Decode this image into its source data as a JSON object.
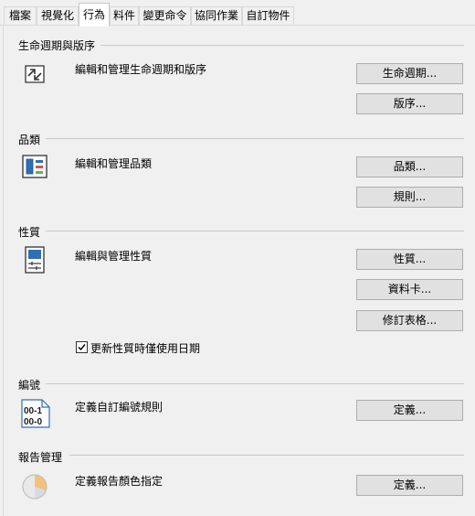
{
  "tabs": [
    {
      "label": "檔案",
      "active": false
    },
    {
      "label": "視覺化",
      "active": false
    },
    {
      "label": "行為",
      "active": true
    },
    {
      "label": "料件",
      "active": false
    },
    {
      "label": "變更命令",
      "active": false
    },
    {
      "label": "協同作業",
      "active": false
    },
    {
      "label": "自訂物件",
      "active": false
    }
  ],
  "groups": {
    "lifecycle": {
      "title": "生命週期與版序",
      "description": "編輯和管理生命週期和版序",
      "icon": "lifecycle-icon",
      "buttons": [
        "生命週期...",
        "版序..."
      ]
    },
    "category": {
      "title": "品類",
      "description": "編輯和管理品類",
      "icon": "category-icon",
      "buttons": [
        "品類...",
        "規則..."
      ]
    },
    "property": {
      "title": "性質",
      "description": "編輯與管理性質",
      "icon": "property-icon",
      "buttons": [
        "性質...",
        "資料卡...",
        "修訂表格..."
      ],
      "checkbox": {
        "label": "更新性質時僅使用日期",
        "checked": true
      }
    },
    "numbering": {
      "title": "編號",
      "description": "定義自訂編號規則",
      "icon": "numbering-icon",
      "icon_text": [
        "00-1",
        "00-0"
      ],
      "buttons": [
        "定義..."
      ]
    },
    "report": {
      "title": "報告管理",
      "description": "定義報告顏色指定",
      "icon": "pie-chart-icon",
      "buttons": [
        "定義..."
      ]
    }
  },
  "colors": {
    "background": "#f0f0f0",
    "button": "#e1e1e1",
    "button_border": "#adadad"
  }
}
